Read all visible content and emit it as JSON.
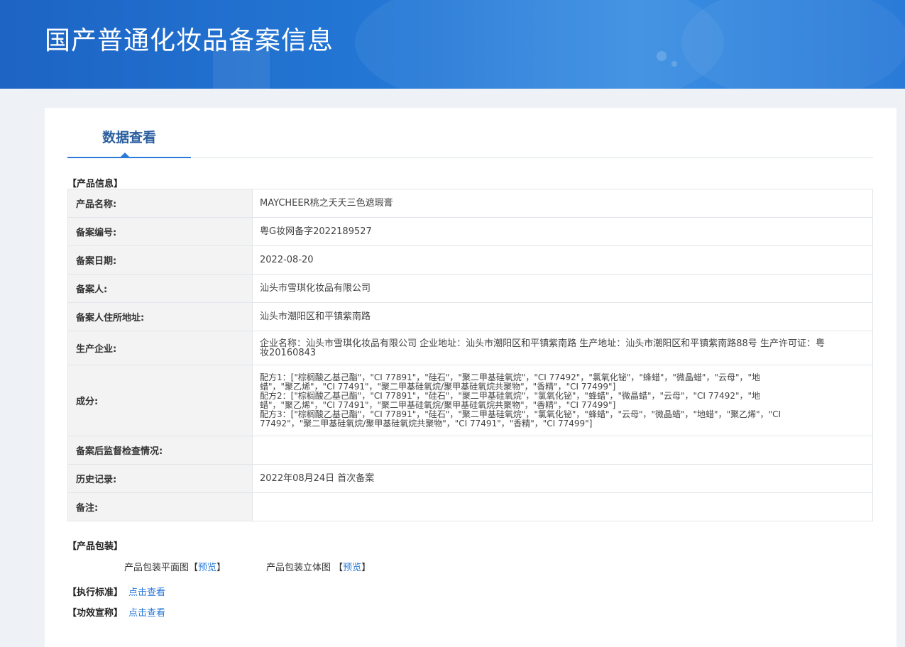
{
  "header": {
    "title": "国产普通化妆品备案信息"
  },
  "tabs": [
    {
      "label": "数据查看"
    }
  ],
  "product_info": {
    "section_title": "【产品信息】",
    "rows": [
      {
        "label": "产品名称:",
        "value": "MAYCHEER桃之夭夭三色遮瑕膏"
      },
      {
        "label": "备案编号:",
        "value": "粤G妆网备字2022189527"
      },
      {
        "label": "备案日期:",
        "value": "2022-08-20"
      },
      {
        "label": "备案人:",
        "value": "汕头市雪琪化妆品有限公司"
      },
      {
        "label": "备案人住所地址:",
        "value": "汕头市潮阳区和平镇紫南路"
      },
      {
        "label": "生产企业:",
        "value_lines": [
          "企业名称：汕头市雪琪化妆品有限公司 企业地址：汕头市潮阳区和平镇紫南路 生产地址：汕头市潮阳区和平镇紫南路88号 生产许可证：粤",
          "妆20160843"
        ]
      },
      {
        "label": "成分:",
        "value_lines": [
          "配方1：[\"棕榈酸乙基己酯\"，\"CI 77891\"，\"硅石\"，\"聚二甲基硅氧烷\"，\"CI 77492\"，\"氯氧化铋\"，\"蜂蜡\"，\"微晶蜡\"，\"云母\"，\"地",
          "蜡\"，\"聚乙烯\"，\"CI 77491\"，\"聚二甲基硅氧烷/聚甲基硅氧烷共聚物\"，\"香精\"，\"CI 77499\"]",
          "配方2：[\"棕榈酸乙基己酯\"，\"CI 77891\"，\"硅石\"，\"聚二甲基硅氧烷\"，\"氯氧化铋\"，\"蜂蜡\"，\"微晶蜡\"，\"云母\"，\"CI 77492\"，\"地",
          "蜡\"，\"聚乙烯\"，\"CI 77491\"，\"聚二甲基硅氧烷/聚甲基硅氧烷共聚物\"，\"香精\"，\"CI 77499\"]",
          "配方3：[\"棕榈酸乙基己酯\"，\"CI 77891\"，\"硅石\"，\"聚二甲基硅氧烷\"，\"氯氧化铋\"，\"蜂蜡\"，\"云母\"，\"微晶蜡\"，\"地蜡\"，\"聚乙烯\"，\"CI",
          "77492\"，\"聚二甲基硅氧烷/聚甲基硅氧烷共聚物\"，\"CI 77491\"，\"香精\"，\"CI 77499\"]"
        ]
      },
      {
        "label": "备案后监督检查情况:",
        "value": ""
      },
      {
        "label": "历史记录:",
        "value": "2022年08月24日 首次备案"
      },
      {
        "label": "备注:",
        "value": ""
      }
    ]
  },
  "packaging": {
    "section_title": "【产品包装】",
    "flat_label": "产品包装平面图",
    "solid_label": "产品包装立体图",
    "bracket_open": "【",
    "bracket_close": "】",
    "preview_link": "预览"
  },
  "standard": {
    "label": "【执行标准】",
    "link": "点击查看"
  },
  "efficacy": {
    "label": "【功效宣称】",
    "link": "点击查看"
  }
}
